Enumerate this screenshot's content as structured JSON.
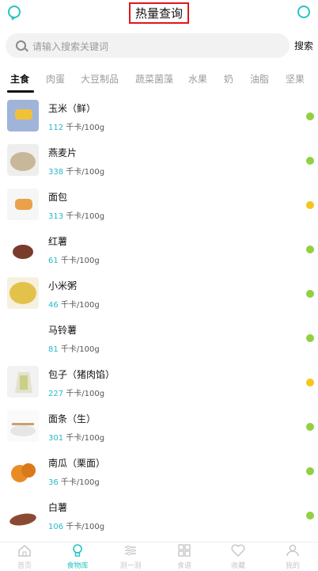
{
  "header": {
    "title": "热量查询",
    "left_icon": "message-icon",
    "right_icon": "circle-icon",
    "accent_color": "#27c4c0"
  },
  "search": {
    "placeholder": "请输入搜索关键词",
    "button_label": "搜索"
  },
  "tabs": [
    "主食",
    "肉蛋",
    "大豆制品",
    "蔬菜菌藻",
    "水果",
    "奶",
    "油脂",
    "坚果"
  ],
  "active_tab": "主食",
  "unit": "千卡/100g",
  "foods": [
    {
      "name": "玉米（鲜）",
      "kcal": "112",
      "status_color": "#8fd13f"
    },
    {
      "name": "燕麦片",
      "kcal": "338",
      "status_color": "#8fd13f"
    },
    {
      "name": "面包",
      "kcal": "313",
      "status_color": "#f5c51c"
    },
    {
      "name": "红薯",
      "kcal": "61",
      "status_color": "#8fd13f"
    },
    {
      "name": "小米粥",
      "kcal": "46",
      "status_color": "#8fd13f"
    },
    {
      "name": "马铃薯",
      "kcal": "81",
      "status_color": "#8fd13f"
    },
    {
      "name": "包子（猪肉馅）",
      "kcal": "227",
      "status_color": "#f5c51c"
    },
    {
      "name": "面条（生）",
      "kcal": "301",
      "status_color": "#8fd13f"
    },
    {
      "name": "南瓜（栗面）",
      "kcal": "36",
      "status_color": "#8fd13f"
    },
    {
      "name": "白薯",
      "kcal": "106",
      "status_color": "#8fd13f"
    }
  ],
  "bottom_nav": [
    {
      "label": "首页",
      "icon": "home-icon"
    },
    {
      "label": "食物库",
      "icon": "bulb-icon"
    },
    {
      "label": "测一测",
      "icon": "sliders-icon"
    },
    {
      "label": "食谱",
      "icon": "grid-icon"
    },
    {
      "label": "收藏",
      "icon": "heart-icon"
    },
    {
      "label": "我的",
      "icon": "user-icon"
    }
  ],
  "active_nav": "食物库"
}
